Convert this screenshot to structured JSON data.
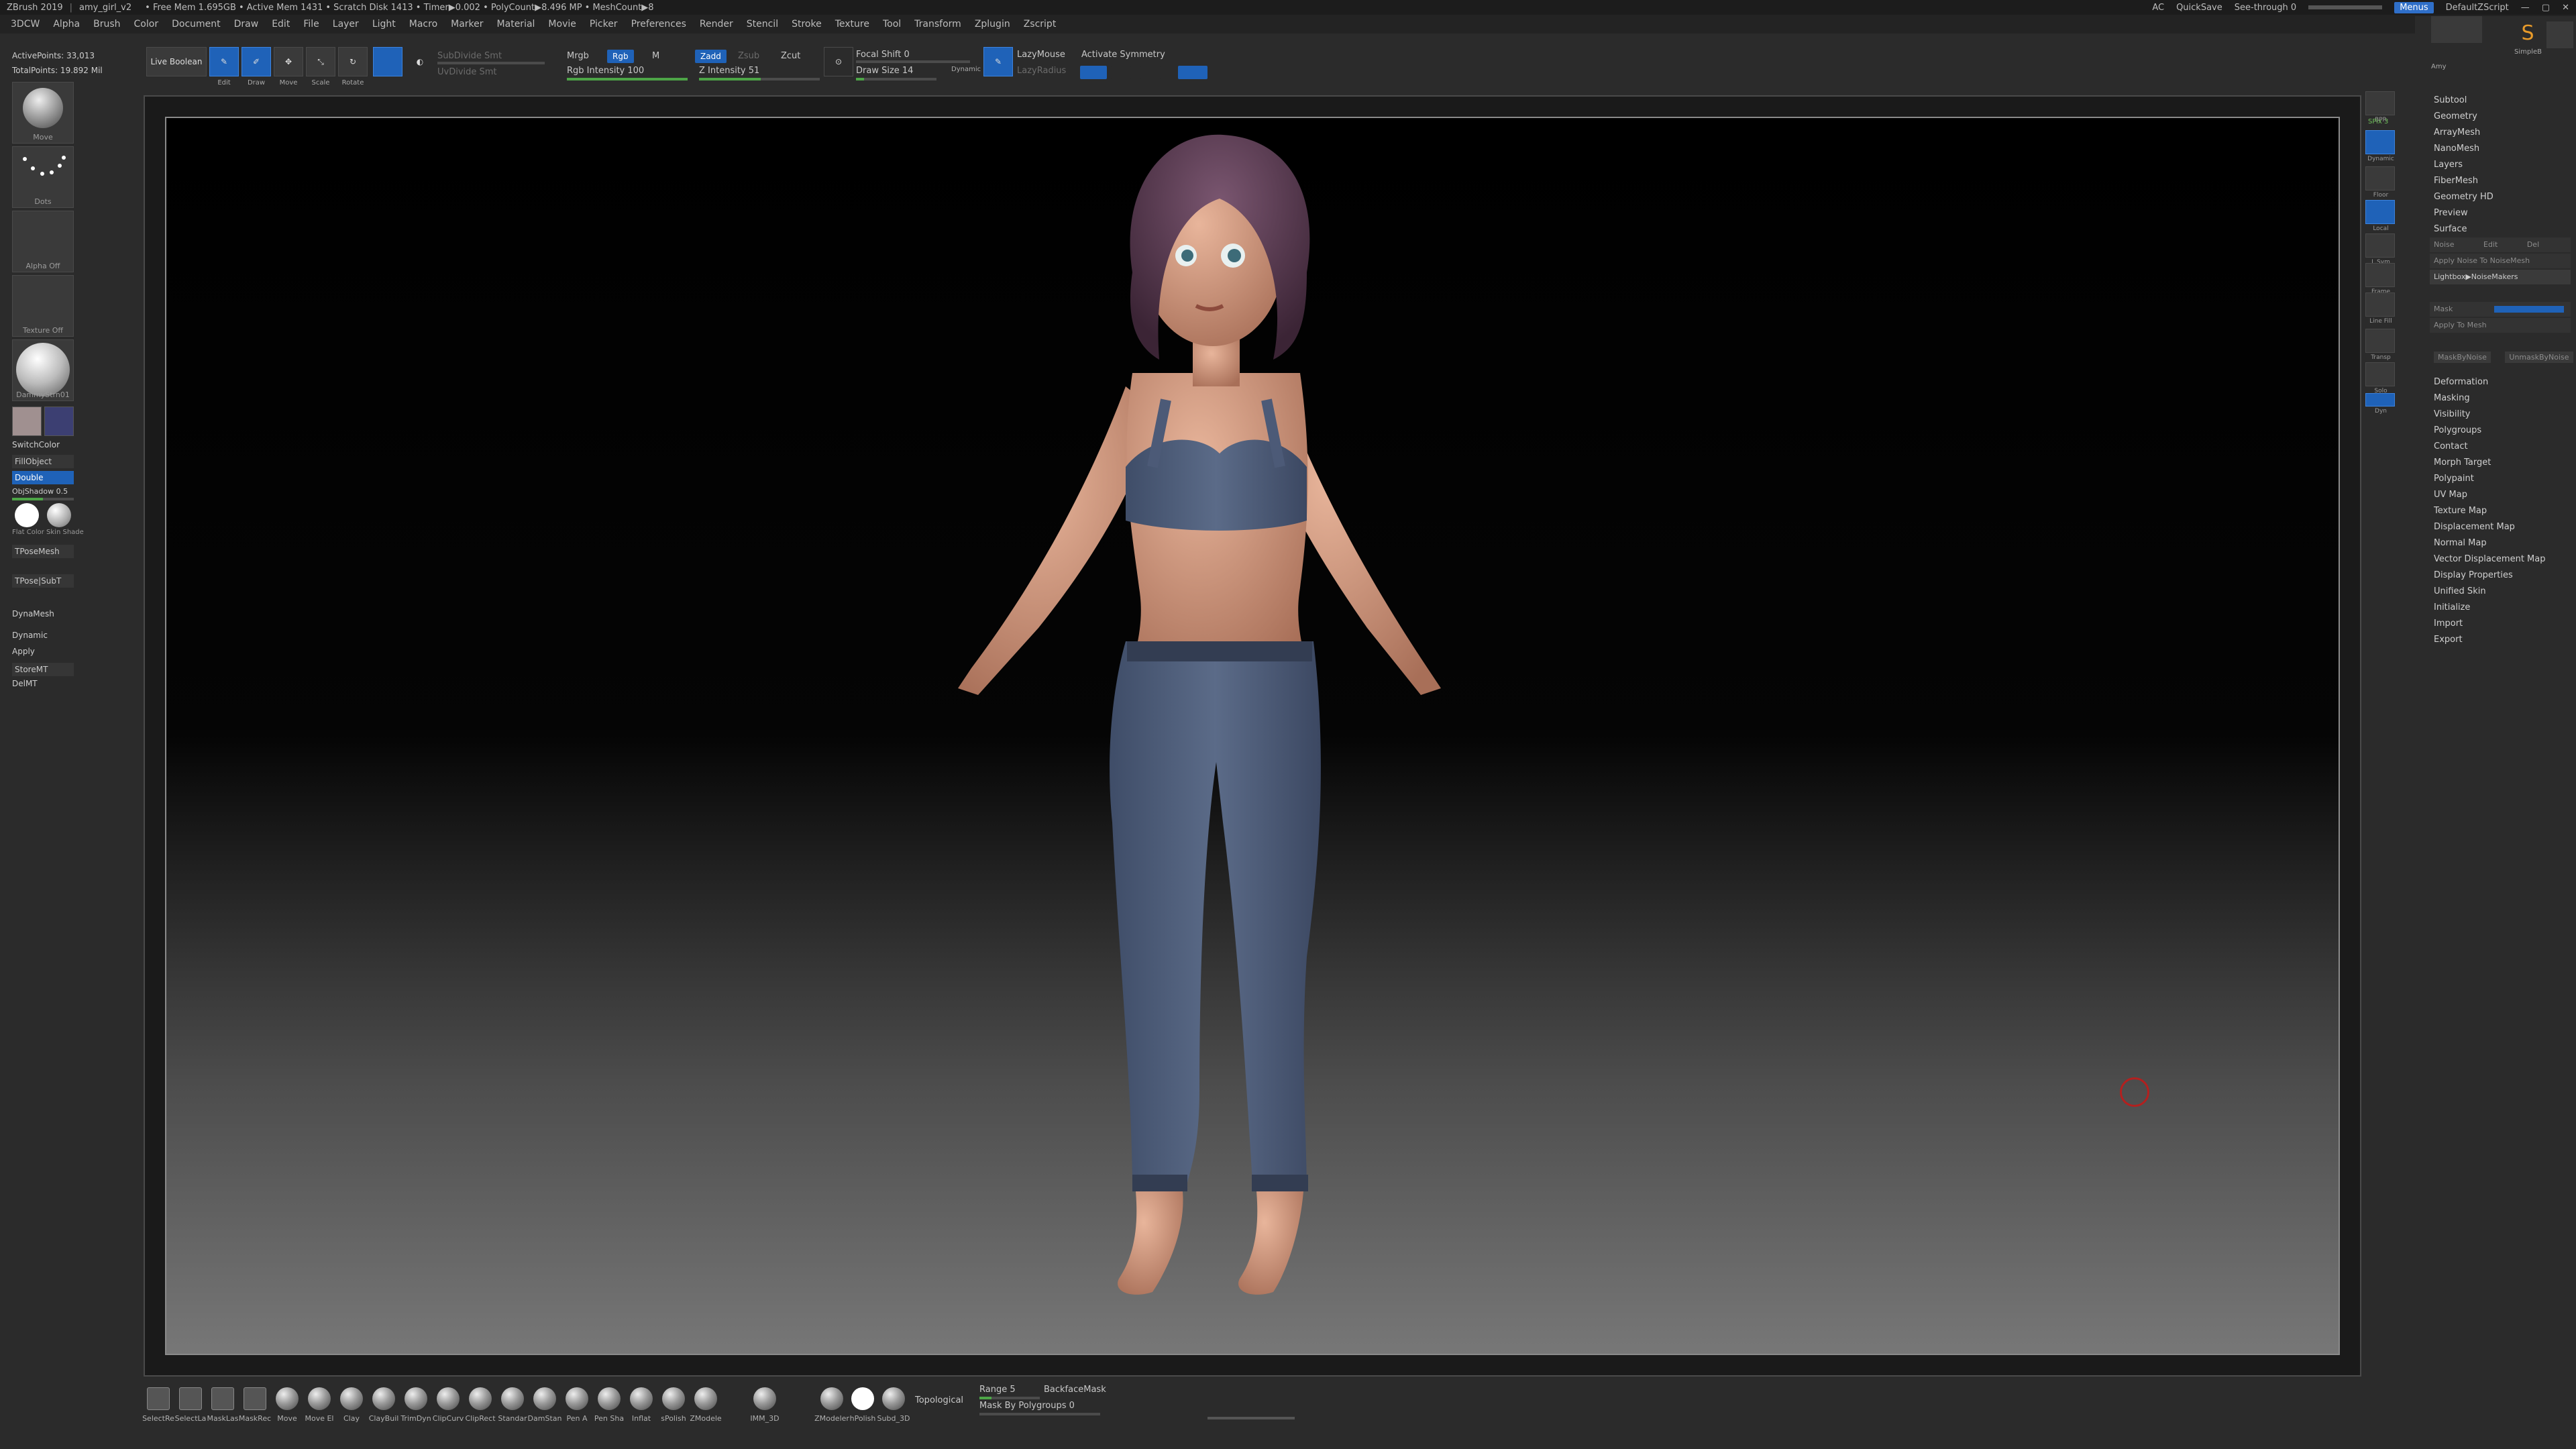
{
  "titlebar": {
    "app": "ZBrush 2019",
    "file": "amy_girl_v2",
    "stats": "• Free Mem 1.695GB • Active Mem 1431 • Scratch Disk 1413 • Timer▶0.002 • PolyCount▶8.496 MP • MeshCount▶8",
    "ac": "AC",
    "quicksave": "QuickSave",
    "see_through": "See-through",
    "see_through_value": "0",
    "see_through_fraction": 0.0,
    "menus_btn": "Menus",
    "script_label": "DefaultZScript"
  },
  "menubar": [
    "3DCW",
    "Alpha",
    "Brush",
    "Color",
    "Document",
    "Draw",
    "Edit",
    "File",
    "Layer",
    "Light",
    "Macro",
    "Marker",
    "Material",
    "Movie",
    "Picker",
    "Preferences",
    "Render",
    "Stencil",
    "Stroke",
    "Texture",
    "Tool",
    "Transform",
    "Zplugin",
    "Zscript"
  ],
  "shelf": {
    "live_boolean": "Live Boolean",
    "tools": [
      {
        "name": "Edit",
        "on": true
      },
      {
        "name": "Draw",
        "on": true
      },
      {
        "name": "Move",
        "on": false
      },
      {
        "name": "Scale",
        "on": false
      },
      {
        "name": "Rotate",
        "on": false
      }
    ],
    "subdivide_smt": "SubDivide Smt",
    "uv_divide_smt": "UvDivide Smt",
    "mrgb": "Mrgb",
    "rgb": "Rgb",
    "m": "M",
    "rgb_intensity": "Rgb Intensity 100",
    "rgb_intensity_value": 100,
    "zadd": "Zadd",
    "zsub": "Zsub",
    "zcut": "Zcut",
    "z_intensity": "Z Intensity 51",
    "z_intensity_value": 51,
    "focal_shift": "Focal Shift 0",
    "draw_size": "Draw Size 14",
    "dynamic": "Dynamic",
    "lazymouse": "LazyMouse",
    "lazyradius": "LazyRadius",
    "activate_symmetry": "Activate Symmetry"
  },
  "left": {
    "active_points": "ActivePoints: 33,013",
    "total_points": "TotalPoints: 19.892 Mil",
    "tiles": [
      "Move",
      "Dots",
      "Alpha Off",
      "Texture Off",
      "DammyStrn01"
    ],
    "swatch_main": "#a09090",
    "swatch_secondary": "#3c3f72",
    "switch_color": "SwitchColor",
    "fill_object": "FillObject",
    "double": "Double",
    "obj_shadow": "ObjShadow 0.5",
    "mat_labels": "Flat Color  Skin Shade",
    "tpose_mesh": "TPoseMesh",
    "tpose_subt": "TPose|SubT",
    "dynamesh": "DynaMesh",
    "dynamic": "Dynamic",
    "apply": "Apply",
    "store_mt": "StoreMT",
    "del_mt": "DelMT"
  },
  "right_icons": [
    {
      "name": "BPR",
      "on": false
    },
    {
      "name": "SPix 3",
      "on": false
    },
    {
      "name": "Dynamic",
      "on": true
    },
    {
      "name": "Floor",
      "on": false
    },
    {
      "name": "Local",
      "on": true
    },
    {
      "name": "L.Sym",
      "on": false
    },
    {
      "name": "Frame",
      "on": false
    },
    {
      "name": "Line Fill",
      "on": false
    },
    {
      "name": "Transp",
      "on": false
    },
    {
      "name": "Solo",
      "on": false
    },
    {
      "name": "Dyn",
      "on": true
    }
  ],
  "tray": {
    "top_thumbs": [
      "SimpleB",
      "Amy"
    ],
    "items": [
      "Subtool",
      "Geometry",
      "ArrayMesh",
      "NanoMesh",
      "Layers",
      "FiberMesh",
      "Geometry HD",
      "Preview",
      "Surface"
    ],
    "surface_sub": {
      "noise": "Noise",
      "edit": "Edit",
      "del": "Del",
      "apply_noise_to_noisemesh": "Apply Noise To NoiseMesh",
      "lightbox_noisemakers": "Lightbox▶NoiseMakers",
      "mask": "Mask",
      "apply_to_mesh": "Apply To Mesh",
      "mask_by_noise": "MaskByNoise",
      "unmask_by_noise": "UnmaskByNoise"
    },
    "items2": [
      "Deformation",
      "Masking",
      "Visibility",
      "Polygroups",
      "Contact",
      "Morph Target",
      "Polypaint",
      "UV Map",
      "Texture Map",
      "Displacement Map",
      "Normal Map",
      "Vector Displacement Map",
      "Display Properties",
      "Unified Skin",
      "Initialize",
      "Import",
      "Export"
    ]
  },
  "bottom": {
    "brushes": [
      "SelectRe",
      "SelectLa",
      "MaskLas",
      "MaskRec",
      "Move",
      "Move El",
      "Clay",
      "ClayBuil",
      "TrimDyn",
      "ClipCurv",
      "ClipRect",
      "Standar",
      "DamStan",
      "Pen A",
      "Pen Sha",
      "Inflat",
      "sPolish",
      "ZModele"
    ],
    "imm": "IMM_3D",
    "zmodeler": "ZModeler",
    "hpolish": "hPolish",
    "subpolish": "Subd_3D",
    "topological": "Topological",
    "range": "Range 5",
    "backface_mask": "BackfaceMask",
    "mask_by_polygroups": "Mask By Polygroups 0"
  },
  "colors": {
    "accent": "#1f62b8",
    "cursor_ring": "#b3201f",
    "skin": "#d99f83",
    "outfit": "#55647f",
    "hair": "#5f4054"
  }
}
